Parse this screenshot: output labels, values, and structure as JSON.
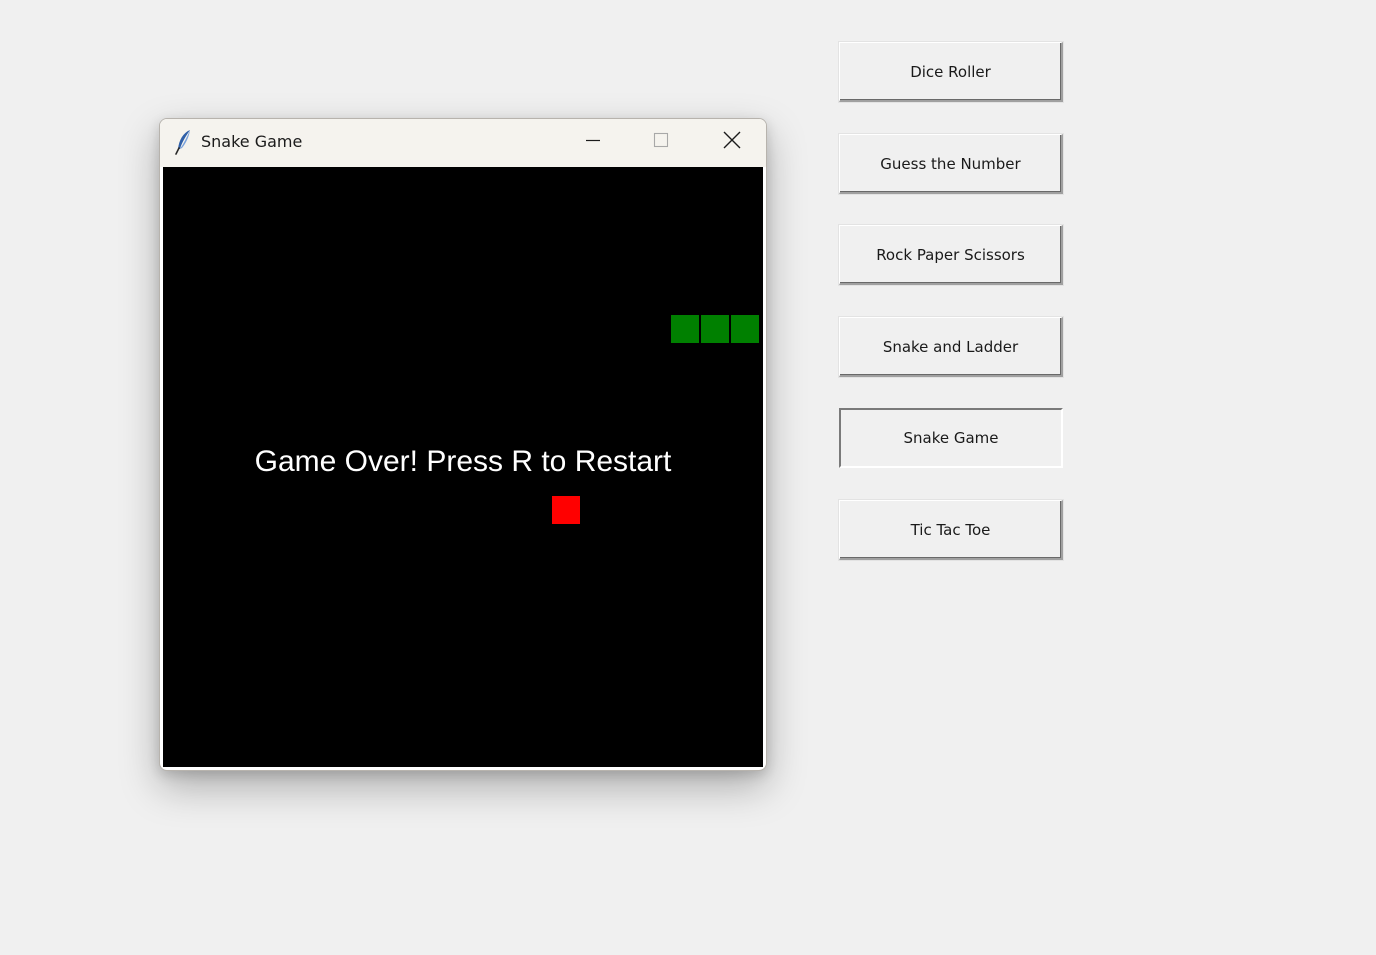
{
  "launcher": {
    "buttons": [
      {
        "label": "Dice Roller"
      },
      {
        "label": "Guess the Number"
      },
      {
        "label": "Rock Paper Scissors"
      },
      {
        "label": "Snake and Ladder"
      },
      {
        "label": "Snake Game"
      },
      {
        "label": "Tic Tac Toe"
      }
    ],
    "active_button": "Snake Game"
  },
  "window": {
    "title": "Snake Game",
    "icon": "feather-icon",
    "controls": [
      "minimize-icon",
      "maximize-icon",
      "close-icon"
    ]
  },
  "game": {
    "message": "Game Over! Press R to Restart",
    "background_color": "#000000",
    "snake_color": "#008000",
    "food_color": "#ff0000",
    "snake_length": 3
  }
}
